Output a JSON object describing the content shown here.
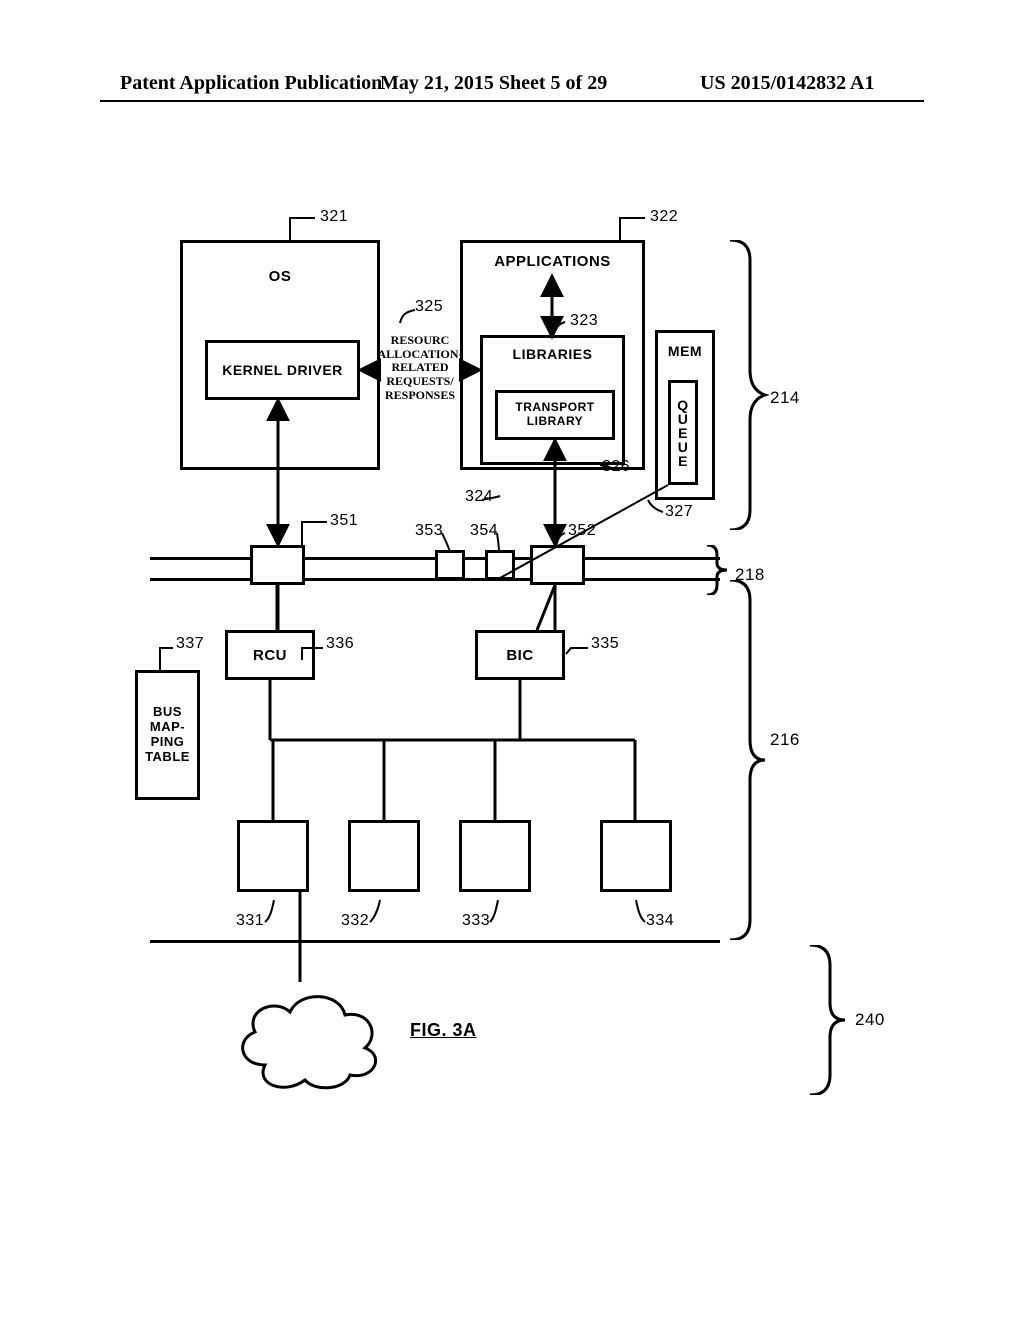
{
  "header": {
    "left": "Patent Application Publication",
    "center": "May 21, 2015  Sheet 5 of 29",
    "right": "US 2015/0142832 A1"
  },
  "labels": {
    "os": "OS",
    "kernel_driver": "KERNEL DRIVER",
    "applications": "APPLICATIONS",
    "libraries": "LIBRARIES",
    "transport_library": "TRANSPORT\nLIBRARY",
    "mem": "MEM",
    "queue": "QUEUE",
    "rcu": "RCU",
    "bic": "BIC",
    "bus_mapping_table": "BUS\nMAP-\nPING\nTABLE",
    "resource_msg": "RESOURC\nALLOCATION-\nRELATED\nREQUESTS/\nRESPONSES"
  },
  "refs": {
    "r321": "321",
    "r322": "322",
    "r323": "323",
    "r324": "324",
    "r325": "325",
    "r326": "326",
    "r327": "327",
    "r331": "331",
    "r332": "332",
    "r333": "333",
    "r334": "334",
    "r335": "335",
    "r336": "336",
    "r337": "337",
    "r351": "351",
    "r352": "352",
    "r353": "353",
    "r354": "354",
    "r214": "214",
    "r216": "216",
    "r218": "218",
    "r240": "240"
  },
  "figure": {
    "caption": "FIG. 3A"
  }
}
